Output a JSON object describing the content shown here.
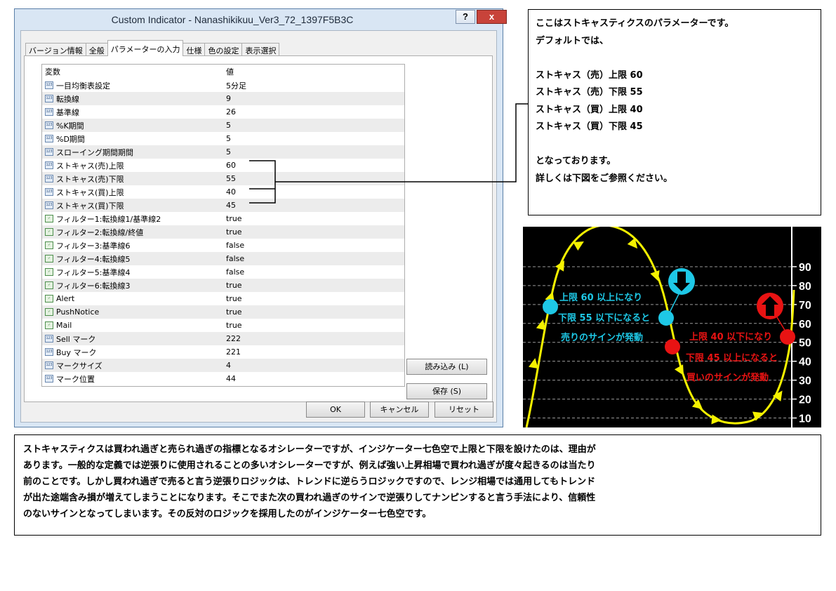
{
  "window": {
    "title": "Custom Indicator - Nanashikikuu_Ver3_72_1397F5B3C",
    "help_label": "?",
    "close_label": "x"
  },
  "tabs": [
    "バージョン情報",
    "全般",
    "パラメーターの入力",
    "仕様",
    "色の設定",
    "表示選択"
  ],
  "table": {
    "header_var": "変数",
    "header_val": "値",
    "rows": [
      {
        "type": "123",
        "name": "一目均衡表設定",
        "value": "5分足"
      },
      {
        "type": "123",
        "name": "転換線",
        "value": "9"
      },
      {
        "type": "123",
        "name": "基準線",
        "value": "26"
      },
      {
        "type": "123",
        "name": "%K期間",
        "value": "5"
      },
      {
        "type": "123",
        "name": "%D期間",
        "value": "5"
      },
      {
        "type": "123",
        "name": "スローイング期間期間",
        "value": "5"
      },
      {
        "type": "123",
        "name": "ストキャス(売)上限",
        "value": "60"
      },
      {
        "type": "123",
        "name": "ストキャス(売)下限",
        "value": "55"
      },
      {
        "type": "123",
        "name": "ストキャス(買)上限",
        "value": "40"
      },
      {
        "type": "123",
        "name": "ストキャス(買)下限",
        "value": "45"
      },
      {
        "type": "bool",
        "name": "フィルター1:転換線1/基準線2",
        "value": "true"
      },
      {
        "type": "bool",
        "name": "フィルター2:転換線/終値",
        "value": "true"
      },
      {
        "type": "bool",
        "name": "フィルター3:基準線6",
        "value": "false"
      },
      {
        "type": "bool",
        "name": "フィルター4:転換線5",
        "value": "false"
      },
      {
        "type": "bool",
        "name": "フィルター5:基準線4",
        "value": "false"
      },
      {
        "type": "bool",
        "name": "フィルター6:転換線3",
        "value": "true"
      },
      {
        "type": "bool",
        "name": "Alert",
        "value": "true"
      },
      {
        "type": "bool",
        "name": "PushNotice",
        "value": "true"
      },
      {
        "type": "bool",
        "name": "Mail",
        "value": "true"
      },
      {
        "type": "123",
        "name": "Sell マーク",
        "value": "222"
      },
      {
        "type": "123",
        "name": "Buy マーク",
        "value": "221"
      },
      {
        "type": "123",
        "name": "マークサイズ",
        "value": "4"
      },
      {
        "type": "123",
        "name": "マーク位置",
        "value": "44"
      }
    ]
  },
  "buttons": {
    "load": "読み込み (L)",
    "save": "保存 (S)",
    "ok": "OK",
    "cancel": "キャンセル",
    "reset": "リセット"
  },
  "note": {
    "lines": [
      "ここはストキャスティクスのパラメーターです。",
      "デフォルトでは、",
      "",
      "ストキャス（売）上限 60",
      "ストキャス（売）下限 55",
      "ストキャス（買）上限 40",
      "ストキャス（買）下限 45",
      "",
      "となっております。",
      "詳しくは下図をご参照ください。"
    ]
  },
  "chart_data": {
    "type": "line",
    "y_ticks": [
      90,
      80,
      70,
      60,
      50,
      40,
      30,
      20,
      10
    ],
    "ylim": [
      5,
      100
    ],
    "grid": true,
    "annotations": {
      "sell": [
        "上限 60 以上になり",
        "下限 55 以下になると",
        "売りのサインが発動"
      ],
      "buy": [
        "上限 40 以下になり",
        "下限 45 以上になると",
        "買いのサインが発動"
      ]
    },
    "colors": {
      "background": "#000000",
      "line": "#f5f200",
      "sell": "#1ec8e6",
      "buy": "#e81313",
      "grid": "#9a9a9a",
      "axis": "#ffffff"
    }
  },
  "bottom_text": {
    "lines": [
      "ストキャスティクスは買われ過ぎと売られ過ぎの指標となるオシレーターですが、インジケーター七色空で上限と下限を設けたのは、理由が",
      "あります。一般的な定義では逆張りに使用されることの多いオシレーターですが、例えば強い上昇相場で買われ過ぎが度々起きるのは当たり",
      "前のことです。しかし買われ過ぎで売ると言う逆張りロジックは、トレンドに逆らうロジックですので、レンジ相場では通用してもトレンド",
      "が出た途端含み損が増えてしまうことになります。そこでまた次の買われ過ぎのサインで逆張りしてナンピンすると言う手法により、信頼性",
      "のないサインとなってしまいます。その反対のロジックを採用したのがインジケーター七色空です。"
    ]
  }
}
